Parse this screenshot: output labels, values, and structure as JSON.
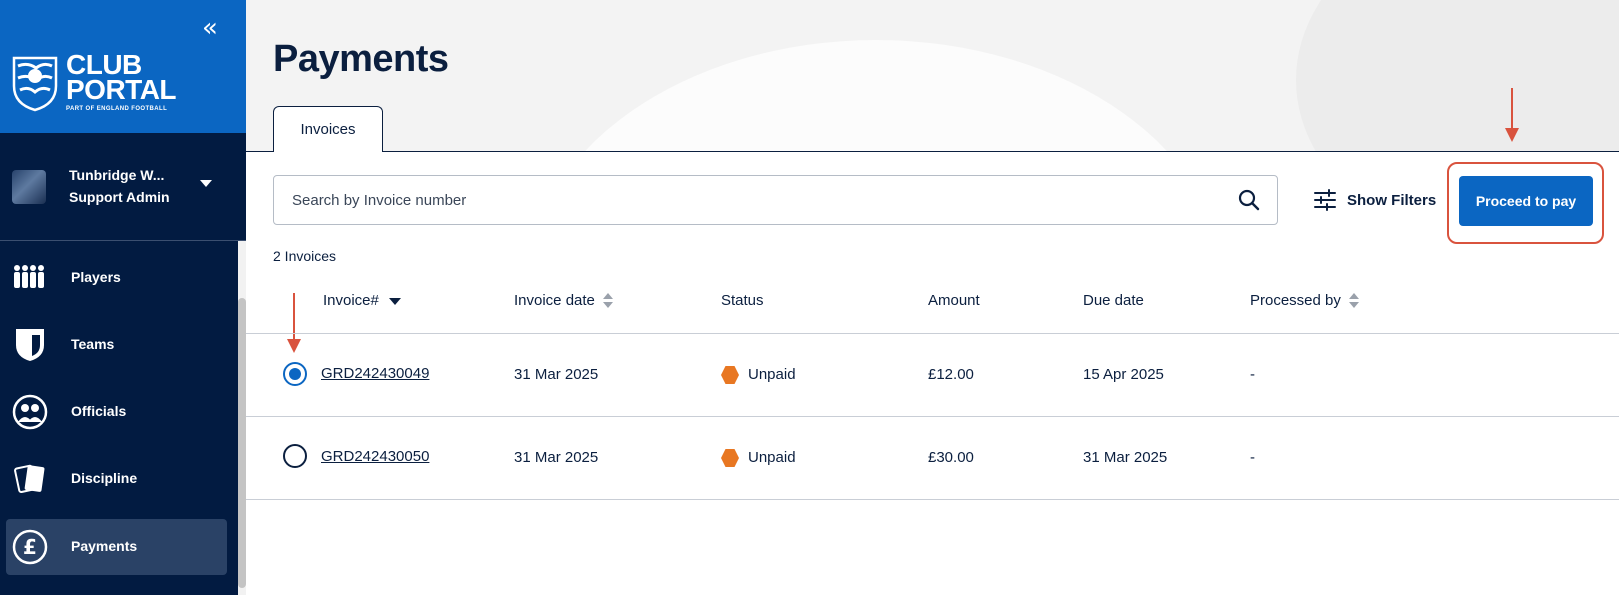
{
  "sidebar": {
    "collapse_icon": "double-chevron-left-icon",
    "brand": {
      "line1": "CLUB",
      "line2": "PORTAL",
      "sub": "PART OF ENGLAND FOOTBALL"
    },
    "club": {
      "name": "Tunbridge W...",
      "role": "Support Admin"
    },
    "items": [
      {
        "label": "Players",
        "icon": "players-icon",
        "active": false
      },
      {
        "label": "Teams",
        "icon": "shield-icon",
        "active": false
      },
      {
        "label": "Officials",
        "icon": "officials-icon",
        "active": false
      },
      {
        "label": "Discipline",
        "icon": "cards-icon",
        "active": false
      },
      {
        "label": "Payments",
        "icon": "pound-icon",
        "active": true
      }
    ]
  },
  "header": {
    "title": "Payments"
  },
  "tabs": [
    {
      "label": "Invoices",
      "active": true
    }
  ],
  "toolbar": {
    "search_placeholder": "Search by Invoice number",
    "filters_label": "Show Filters",
    "pay_label": "Proceed to pay"
  },
  "table": {
    "count": "2 Invoices",
    "columns": [
      "Invoice#",
      "Invoice date",
      "Status",
      "Amount",
      "Due date",
      "Processed by"
    ],
    "rows": [
      {
        "selected": true,
        "invoice": "GRD242430049",
        "invoice_date": "31 Mar 2025",
        "status": "Unpaid",
        "amount": "£12.00",
        "due_date": "15 Apr 2025",
        "processed_by": "-"
      },
      {
        "selected": false,
        "invoice": "GRD242430050",
        "invoice_date": "31 Mar 2025",
        "status": "Unpaid",
        "amount": "£30.00",
        "due_date": "31 Mar 2025",
        "processed_by": "-"
      }
    ]
  },
  "colors": {
    "brand_blue": "#0b66c2",
    "navy": "#021b41",
    "status_unpaid": "#e87722",
    "annotation_red": "#d9533e"
  }
}
